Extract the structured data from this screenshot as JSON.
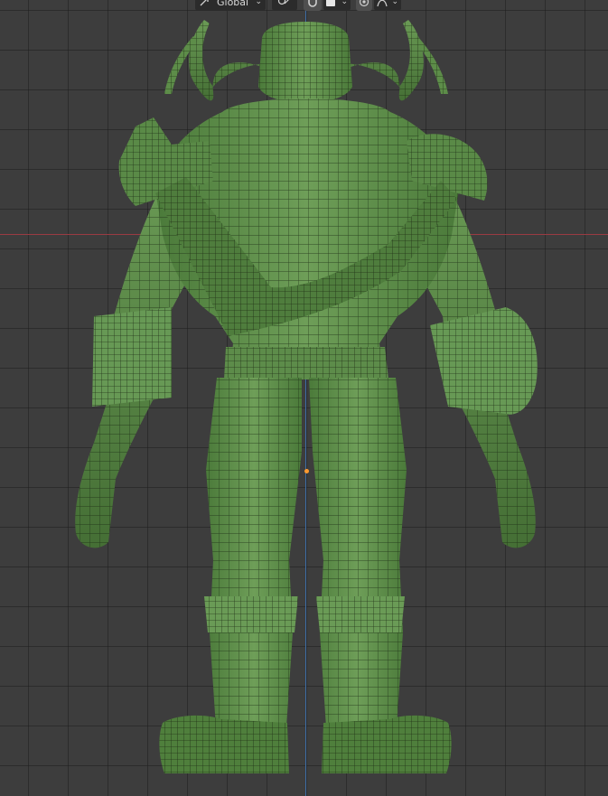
{
  "viewport_header": {
    "orientation_label": "Global",
    "orientation_chevron": "⌄",
    "snap_chevron": "⌄",
    "proportional_chevron": "⌄"
  },
  "colors": {
    "background": "#3d3d3d",
    "grid": "#2f2f2f",
    "x_axis": "#9a3b42",
    "z_axis": "#3f6fa8",
    "mesh_fill": "#5f8f4c",
    "mesh_wire": "#1b2a14",
    "origin_point": "#ff9a2f"
  },
  "icons": {
    "orientation": "transform-orientation-icon",
    "pivot": "transform-pivot-icon",
    "snap": "snap-magnet-icon",
    "snap_target": "snap-target-icon",
    "proportional": "proportional-editing-icon",
    "falloff": "falloff-curve-icon"
  }
}
